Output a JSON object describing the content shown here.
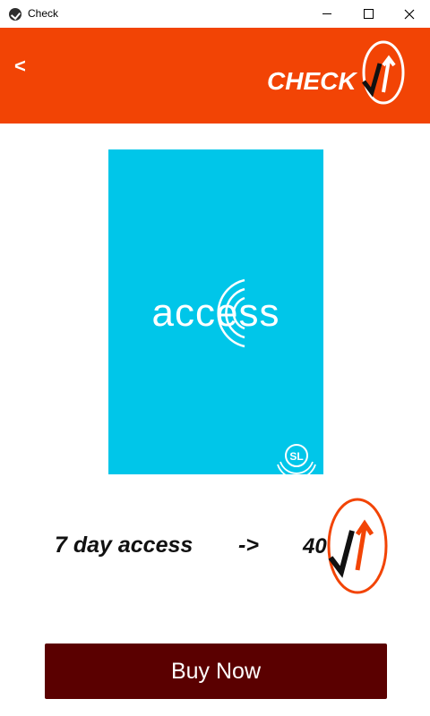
{
  "window": {
    "title": "Check"
  },
  "header": {
    "back_label": "<",
    "brand_text": "CHECK",
    "bg_color": "#f24405"
  },
  "poster": {
    "word": "access",
    "badge": "SL",
    "bg_color": "#00c6e9"
  },
  "offer": {
    "text": "7 day access",
    "arrow": "->",
    "price": "40"
  },
  "actions": {
    "buy_label": "Buy Now",
    "buy_color": "#5a0000"
  }
}
